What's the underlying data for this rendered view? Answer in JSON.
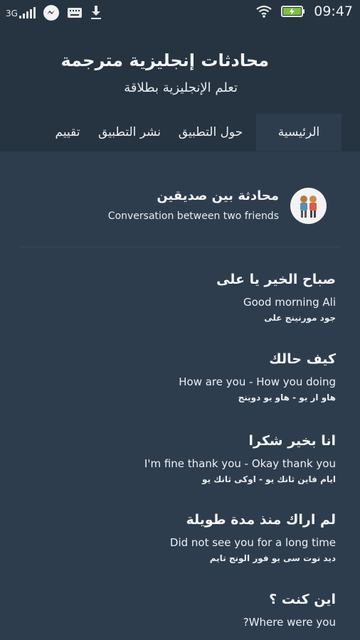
{
  "status_bar": {
    "network": "3G",
    "time": "09:47",
    "icons": [
      "signal-icon",
      "messenger-icon",
      "keyboard-icon",
      "download-icon",
      "wifi-icon",
      "battery-icon"
    ]
  },
  "header": {
    "title": "محادثات إنجليزية مترجمة",
    "subtitle": "تعلم الإنجليزية بطلاقة"
  },
  "tabs": [
    {
      "label": "الرئيسية",
      "active": true
    },
    {
      "label": "حول التطبيق",
      "active": false
    },
    {
      "label": "نشر التطبيق",
      "active": false
    },
    {
      "label": "تقييم",
      "active": false
    }
  ],
  "conversation": {
    "title": "محادثة بين صديقين",
    "subtitle": "Conversation between two friends",
    "icon": "two-friends-icon"
  },
  "entries": [
    {
      "arabic": "صباح الخير يا على",
      "english": "Good morning Ali",
      "transliteration": "جود مورنينج على"
    },
    {
      "arabic": "كيف حالك",
      "english": "How are you - How you doing",
      "transliteration": "هاو ار يو - هاو يو دوينج"
    },
    {
      "arabic": "انا بخير شكرا",
      "english": "I'm fine thank you - Okay thank you",
      "transliteration": "ايام فاين ثانك يو - اوكى ثانك يو"
    },
    {
      "arabic": "لم اراك منذ مدة طويلة",
      "english": "Did not see you for a long time",
      "transliteration": "ديد نوت سى يو فور الونج تايم"
    },
    {
      "arabic": "اين كنت ؟",
      "english": "?Where were you",
      "transliteration": ""
    }
  ],
  "colors": {
    "background": "#2e3d4e",
    "header": "#263442",
    "text": "#ffffff"
  }
}
